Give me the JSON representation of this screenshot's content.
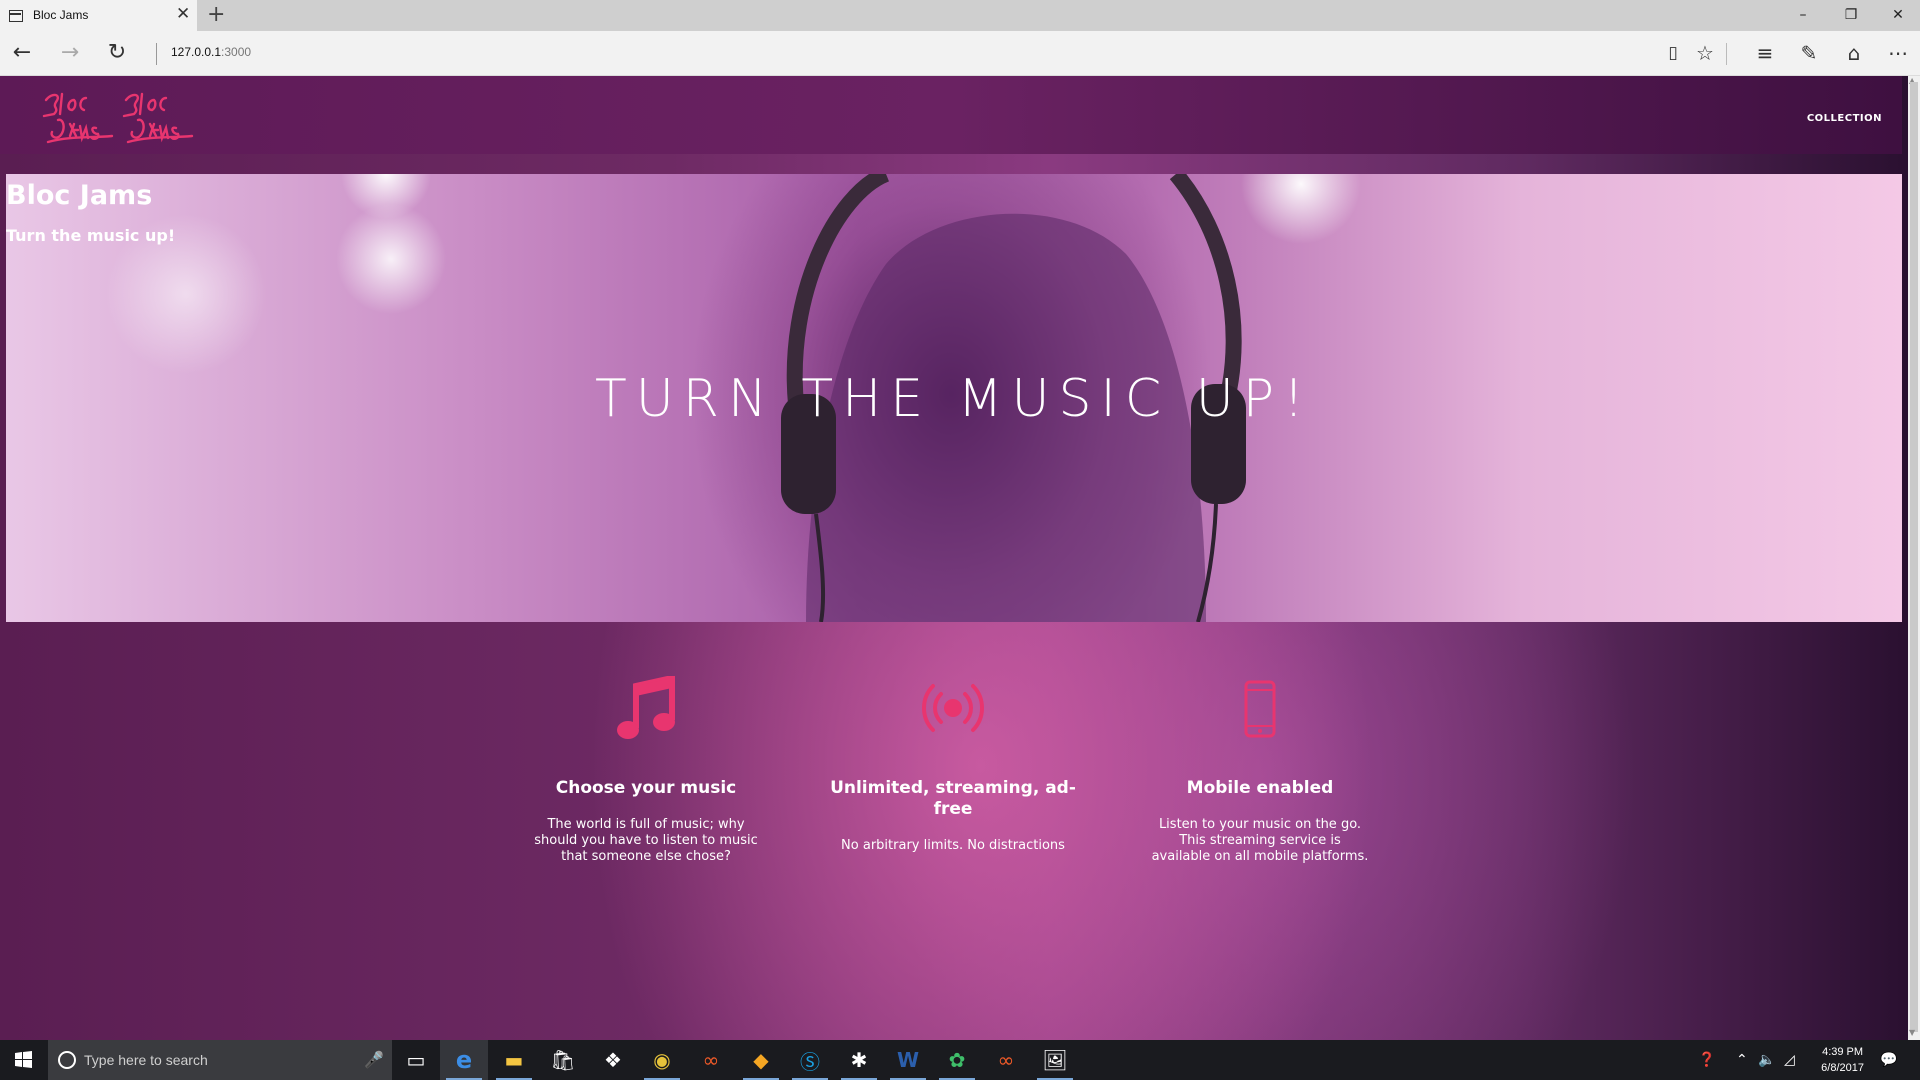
{
  "browser": {
    "tab_title": "Bloc Jams",
    "tab_close": "✕",
    "new_tab": "+",
    "url_host": "127.0.0.1",
    "url_port": ":3000",
    "window_controls": [
      "–",
      "❐",
      "✕"
    ]
  },
  "page": {
    "nav": {
      "collection": "COLLECTION"
    },
    "hero": {
      "title": "Bloc Jams",
      "subtitle": "Turn the music up!",
      "headline": "TURN THE MUSIC UP!"
    },
    "features": [
      {
        "icon": "music-note-icon",
        "title": "Choose your music",
        "description": "The world is full of music; why should you have to listen to music that someone else chose?"
      },
      {
        "icon": "broadcast-icon",
        "title": "Unlimited, streaming, ad-free",
        "description": "No arbitrary limits. No distractions"
      },
      {
        "icon": "mobile-phone-icon",
        "title": "Mobile enabled",
        "description": "Listen to your music on the go. This streaming service is available on all mobile platforms."
      }
    ],
    "accent_color": "#e8356f"
  },
  "taskbar": {
    "search_placeholder": "Type here to search",
    "apps": [
      "task-view",
      "edge",
      "file-explorer",
      "store",
      "dropbox",
      "chrome",
      "app-orange",
      "git",
      "skype",
      "app-slack",
      "word",
      "app-green",
      "app-orange-2",
      "photos"
    ],
    "time": "4:39 PM",
    "date": "6/8/2017"
  }
}
